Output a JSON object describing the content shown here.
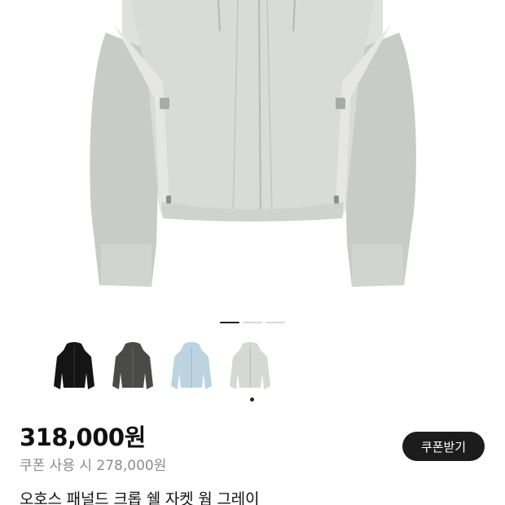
{
  "gallery": {
    "main_image": "jacket-gray-product-photo",
    "indicator_count": 3,
    "active_index": 0
  },
  "color_options": [
    {
      "name": "black",
      "color": "#151515"
    },
    {
      "name": "charcoal",
      "color": "#4a4a48"
    },
    {
      "name": "sky-blue",
      "color": "#bcd4e0"
    },
    {
      "name": "gray",
      "color": "#d6d8d3",
      "selected": true
    }
  ],
  "product": {
    "price": "318,000원",
    "coupon_price": "쿠폰 사용 시 278,000원",
    "coupon_button": "쿠폰받기",
    "title": "오호스 패널드 크롭 쉘 자켓 웜 그레이"
  }
}
